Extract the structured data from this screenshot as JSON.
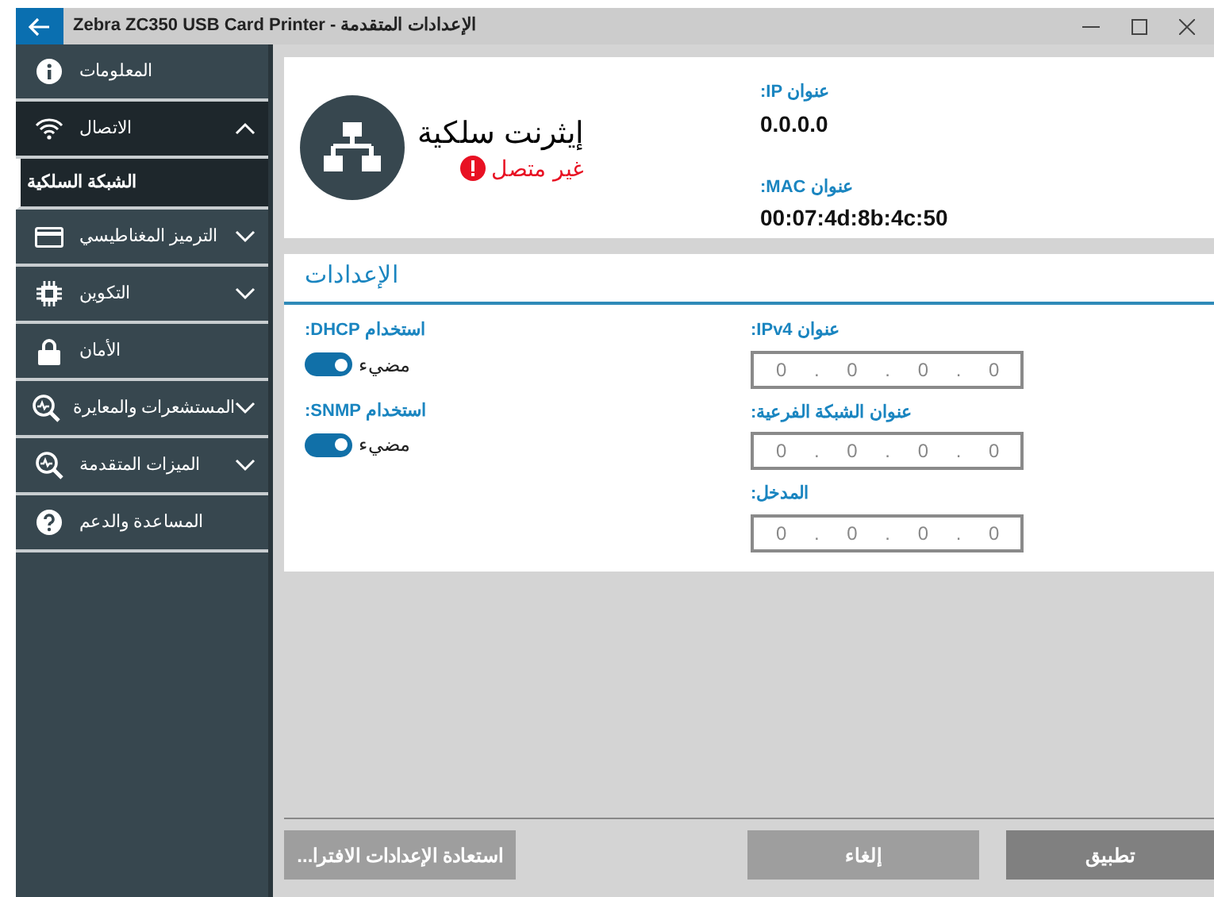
{
  "window": {
    "title": "Zebra ZC350 USB Card Printer - الإعدادات المتقدمة"
  },
  "sidebar": {
    "items": [
      {
        "label": "المعلومات",
        "kind": "info",
        "expanded": false,
        "expandable": false
      },
      {
        "label": "الاتصال",
        "kind": "wifi",
        "expanded": true,
        "expandable": true,
        "children": [
          {
            "label": "الشبكة السلكية",
            "selected": true
          }
        ]
      },
      {
        "label": "الترميز المغناطيسي",
        "kind": "card",
        "expanded": false,
        "expandable": true
      },
      {
        "label": "التكوين",
        "kind": "chip",
        "expanded": false,
        "expandable": true
      },
      {
        "label": "الأمان",
        "kind": "lock",
        "expanded": false,
        "expandable": false
      },
      {
        "label": "المستشعرات والمعايرة",
        "kind": "scope",
        "expanded": false,
        "expandable": true
      },
      {
        "label": "الميزات المتقدمة",
        "kind": "scope",
        "expanded": false,
        "expandable": true
      },
      {
        "label": "المساعدة والدعم",
        "kind": "help",
        "expanded": false,
        "expandable": false
      }
    ]
  },
  "connection": {
    "title": "إيثرنت سلكية",
    "status": "غير متصل",
    "connected": false,
    "ip_label": "عنوان IP:",
    "ip": "0.0.0.0",
    "mac_label": "عنوان MAC:",
    "mac": "00:07:4d:8b:4c:50"
  },
  "settings": {
    "title": "الإعدادات",
    "toggles": [
      {
        "label": "استخدام DHCP:",
        "state_text": "مضيء",
        "on": true
      },
      {
        "label": "استخدام SNMP:",
        "state_text": "مضيء",
        "on": true
      }
    ],
    "fields": [
      {
        "label": "عنوان IPv4:",
        "value": "0 . 0 . 0 . 0"
      },
      {
        "label": "عنوان الشبكة الفرعية:",
        "value": "0 . 0 . 0 . 0"
      },
      {
        "label": "المدخل:",
        "value": "0 . 0 . 0 . 0"
      }
    ]
  },
  "buttons": [
    {
      "label": "تطبيق",
      "kind": "apply"
    },
    {
      "label": "إلغاء",
      "kind": "cancel"
    },
    {
      "label": "استعادة الإعدادات الافترا...",
      "kind": "restore"
    }
  ]
}
